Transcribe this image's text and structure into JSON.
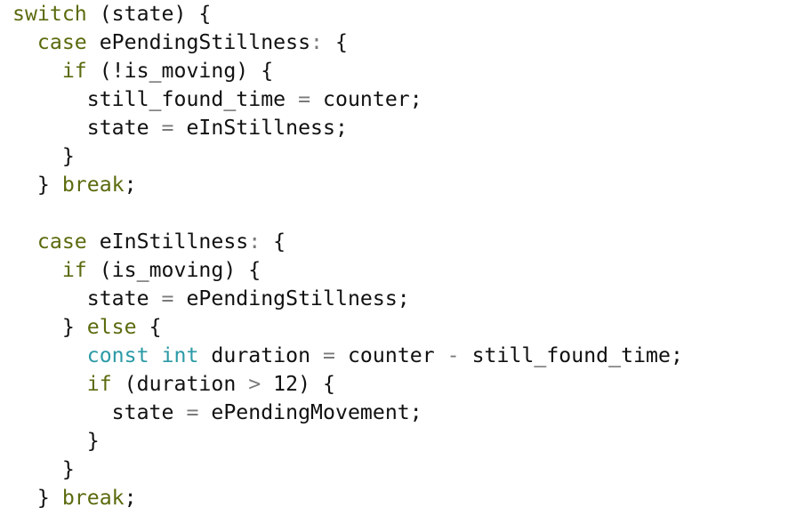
{
  "colors": {
    "keyword": "#5a6b0e",
    "type": "#2b9aa6",
    "operator": "#7a7a7a",
    "plain": "#111111",
    "background": "#ffffff"
  },
  "code": {
    "lines": [
      [
        {
          "t": "switch",
          "c": "kw"
        },
        {
          "t": " (state) {",
          "c": "pl"
        }
      ],
      [
        {
          "t": "  ",
          "c": "pl"
        },
        {
          "t": "case",
          "c": "kw"
        },
        {
          "t": " ePendingStillness",
          "c": "pl"
        },
        {
          "t": ":",
          "c": "op"
        },
        {
          "t": " {",
          "c": "pl"
        }
      ],
      [
        {
          "t": "    ",
          "c": "pl"
        },
        {
          "t": "if",
          "c": "kw"
        },
        {
          "t": " (!is_moving) {",
          "c": "pl"
        }
      ],
      [
        {
          "t": "      still_found_time ",
          "c": "pl"
        },
        {
          "t": "=",
          "c": "op"
        },
        {
          "t": " counter;",
          "c": "pl"
        }
      ],
      [
        {
          "t": "      state ",
          "c": "pl"
        },
        {
          "t": "=",
          "c": "op"
        },
        {
          "t": " eInStillness;",
          "c": "pl"
        }
      ],
      [
        {
          "t": "    }",
          "c": "pl"
        }
      ],
      [
        {
          "t": "  } ",
          "c": "pl"
        },
        {
          "t": "break",
          "c": "kw"
        },
        {
          "t": ";",
          "c": "pl"
        }
      ],
      [],
      [
        {
          "t": "  ",
          "c": "pl"
        },
        {
          "t": "case",
          "c": "kw"
        },
        {
          "t": " eInStillness",
          "c": "pl"
        },
        {
          "t": ":",
          "c": "op"
        },
        {
          "t": " {",
          "c": "pl"
        }
      ],
      [
        {
          "t": "    ",
          "c": "pl"
        },
        {
          "t": "if",
          "c": "kw"
        },
        {
          "t": " (is_moving) {",
          "c": "pl"
        }
      ],
      [
        {
          "t": "      state ",
          "c": "pl"
        },
        {
          "t": "=",
          "c": "op"
        },
        {
          "t": " ePendingStillness;",
          "c": "pl"
        }
      ],
      [
        {
          "t": "    } ",
          "c": "pl"
        },
        {
          "t": "else",
          "c": "kw"
        },
        {
          "t": " {",
          "c": "pl"
        }
      ],
      [
        {
          "t": "      ",
          "c": "pl"
        },
        {
          "t": "const",
          "c": "ty"
        },
        {
          "t": " ",
          "c": "pl"
        },
        {
          "t": "int",
          "c": "ty"
        },
        {
          "t": " duration ",
          "c": "pl"
        },
        {
          "t": "=",
          "c": "op"
        },
        {
          "t": " counter ",
          "c": "pl"
        },
        {
          "t": "-",
          "c": "op"
        },
        {
          "t": " still_found_time;",
          "c": "pl"
        }
      ],
      [
        {
          "t": "      ",
          "c": "pl"
        },
        {
          "t": "if",
          "c": "kw"
        },
        {
          "t": " (duration ",
          "c": "pl"
        },
        {
          "t": ">",
          "c": "op"
        },
        {
          "t": " 12) {",
          "c": "pl"
        }
      ],
      [
        {
          "t": "        state ",
          "c": "pl"
        },
        {
          "t": "=",
          "c": "op"
        },
        {
          "t": " ePendingMovement;",
          "c": "pl"
        }
      ],
      [
        {
          "t": "      }",
          "c": "pl"
        }
      ],
      [
        {
          "t": "    }",
          "c": "pl"
        }
      ],
      [
        {
          "t": "  } ",
          "c": "pl"
        },
        {
          "t": "break",
          "c": "kw"
        },
        {
          "t": ";",
          "c": "pl"
        }
      ]
    ]
  }
}
